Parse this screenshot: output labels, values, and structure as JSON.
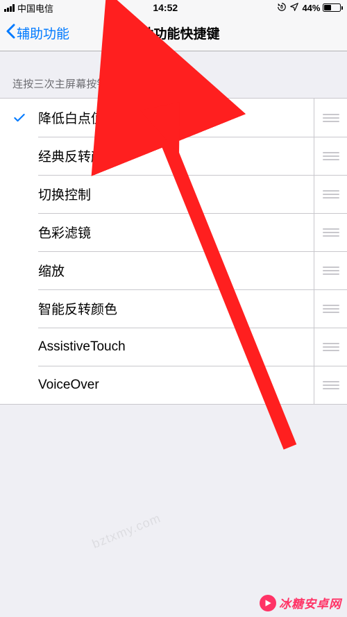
{
  "status": {
    "carrier": "中国电信",
    "time": "14:52",
    "battery_percent": "44%",
    "battery_level": 44
  },
  "nav": {
    "back_label": "辅助功能",
    "title": "辅助功能快捷键"
  },
  "section": {
    "header": "连按三次主屏幕按钮，打开："
  },
  "items": [
    {
      "label": "降低白点值",
      "checked": true
    },
    {
      "label": "经典反转颜色",
      "checked": false
    },
    {
      "label": "切换控制",
      "checked": false
    },
    {
      "label": "色彩滤镜",
      "checked": false
    },
    {
      "label": "缩放",
      "checked": false
    },
    {
      "label": "智能反转颜色",
      "checked": false
    },
    {
      "label": "AssistiveTouch",
      "checked": false
    },
    {
      "label": "VoiceOver",
      "checked": false
    }
  ],
  "annotation": {
    "type": "arrow",
    "color": "#ff1f1f"
  },
  "watermark": {
    "text": "bztxmy.com",
    "brand": "冰糖安卓网"
  }
}
